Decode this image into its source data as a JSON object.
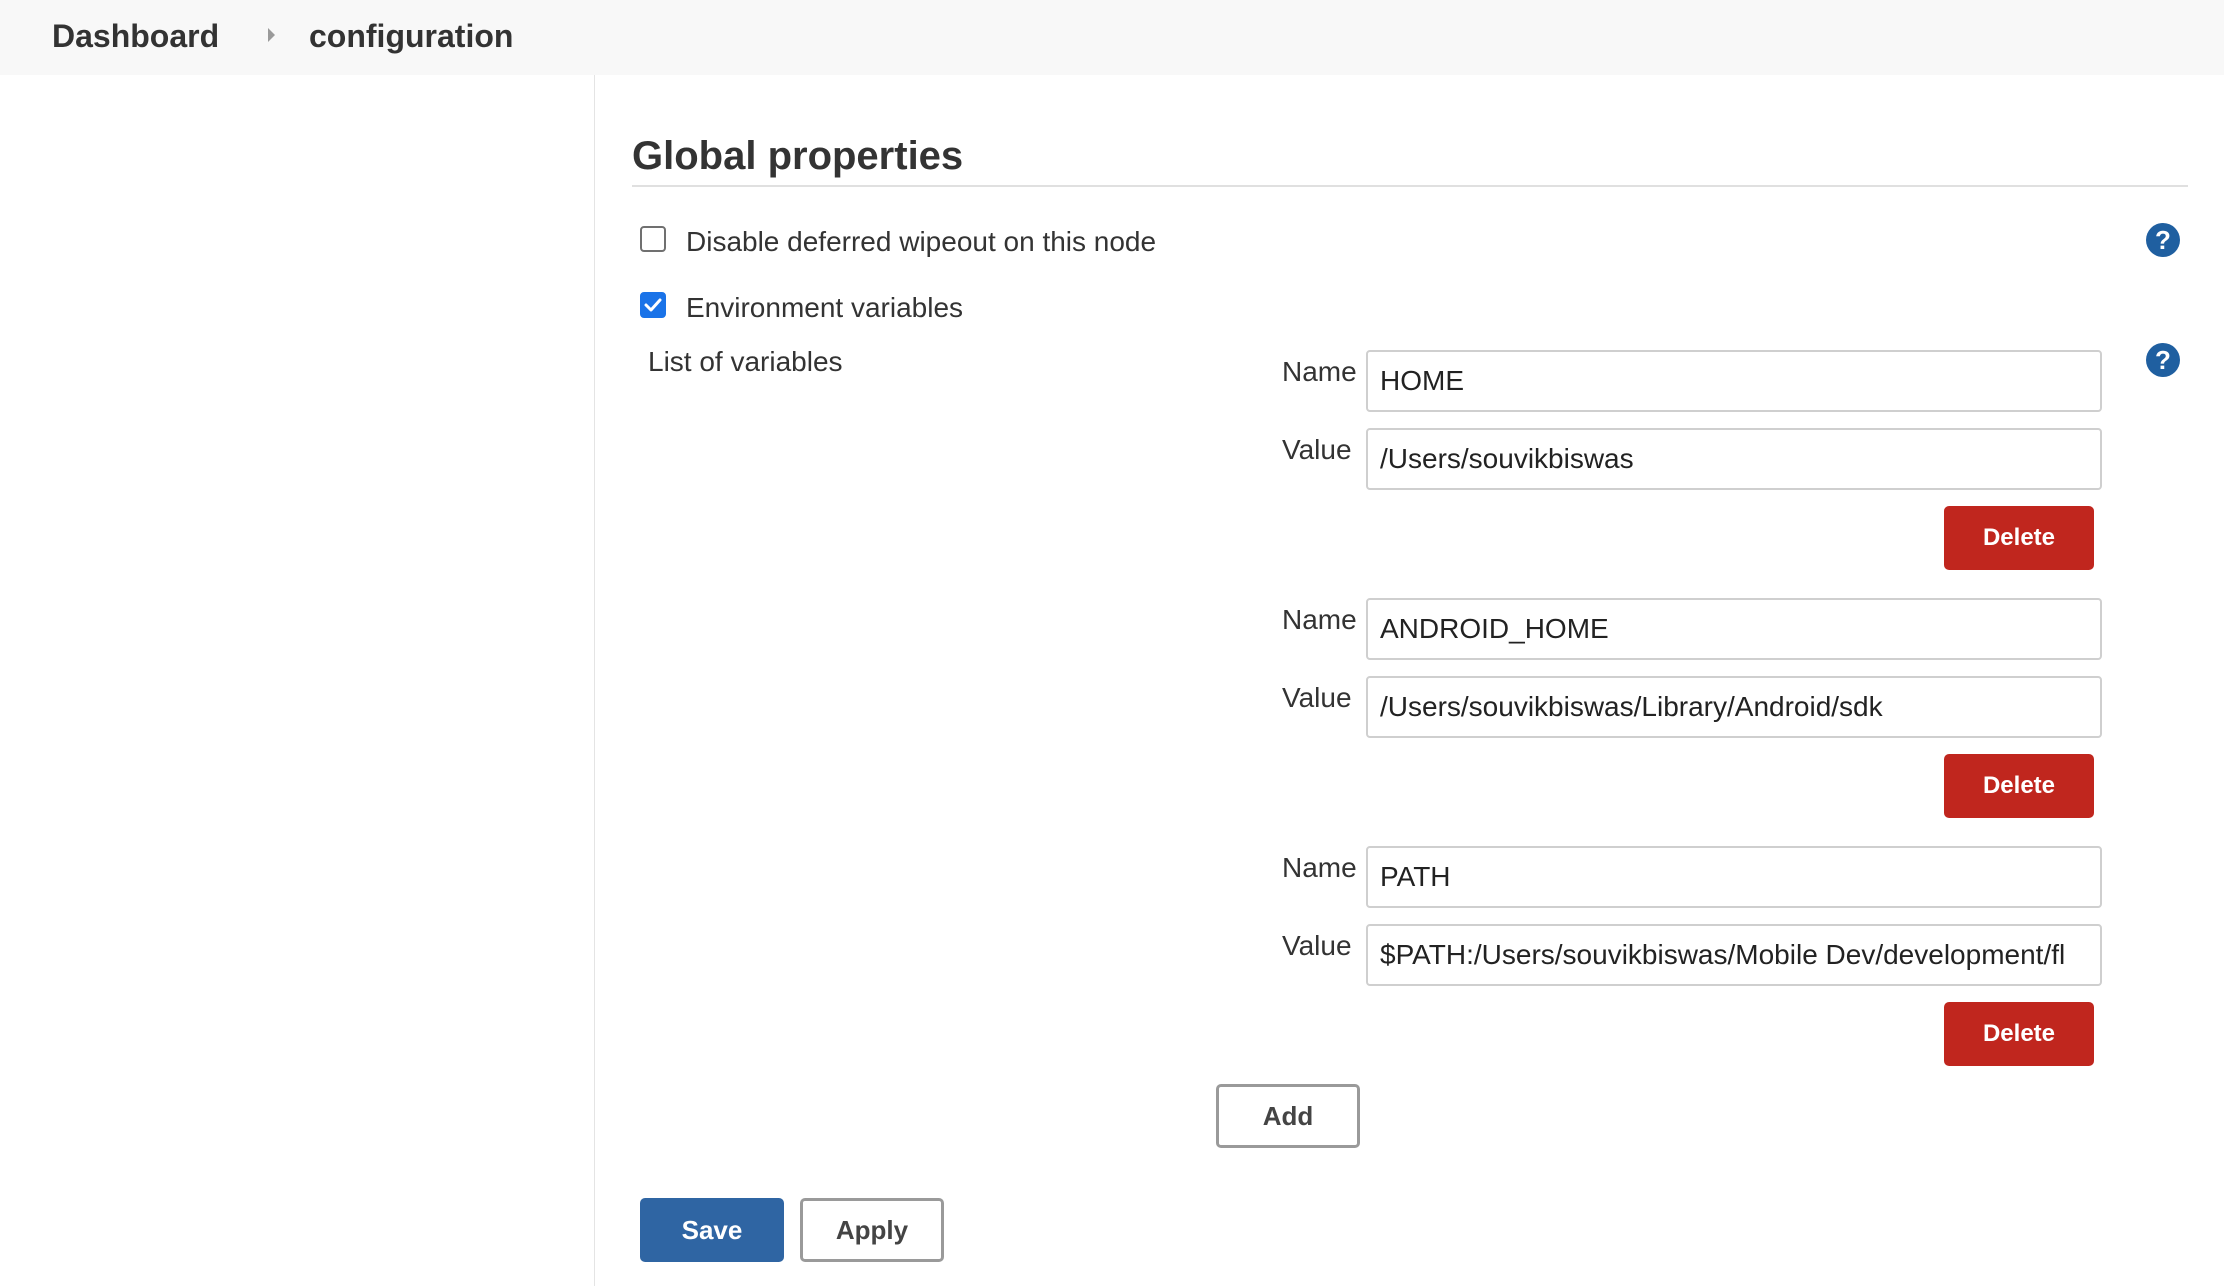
{
  "breadcrumb": {
    "items": [
      "Dashboard",
      "configuration"
    ]
  },
  "section": {
    "title": "Global properties"
  },
  "options": {
    "disable_deferred_wipeout": {
      "label": "Disable deferred wipeout on this node",
      "checked": false
    },
    "environment_variables": {
      "label": "Environment variables",
      "checked": true
    }
  },
  "env_vars": {
    "list_label": "List of variables",
    "name_label": "Name",
    "value_label": "Value",
    "delete_label": "Delete",
    "add_label": "Add",
    "entries": [
      {
        "name": "HOME",
        "value": "/Users/souvikbiswas"
      },
      {
        "name": "ANDROID_HOME",
        "value": "/Users/souvikbiswas/Library/Android/sdk"
      },
      {
        "name": "PATH",
        "value": "$PATH:/Users/souvikbiswas/Mobile Dev/development/fl"
      }
    ]
  },
  "help_icon": "?",
  "actions": {
    "save_label": "Save",
    "apply_label": "Apply"
  },
  "colors": {
    "delete": "#c0261e",
    "save": "#2f65a3",
    "help": "#1f5fa0",
    "checkbox": "#1a73e8"
  }
}
